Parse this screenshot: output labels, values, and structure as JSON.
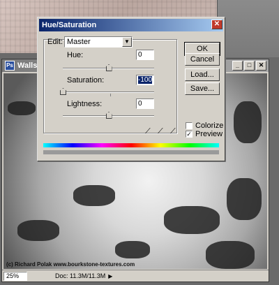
{
  "doc_window": {
    "title": "Walls-pl",
    "zoom": "25%",
    "doc_info": "Doc: 11.3M/11.3M",
    "watermark": "(c) Richard Polak www.bourkstone-textures.com"
  },
  "dialog": {
    "title": "Hue/Saturation",
    "edit_label": "Edit:",
    "edit_value": "Master",
    "hue_label": "Hue:",
    "hue_value": "0",
    "saturation_label": "Saturation:",
    "saturation_value": "-100",
    "lightness_label": "Lightness:",
    "lightness_value": "0",
    "buttons": {
      "ok": "OK",
      "cancel": "Cancel",
      "load": "Load...",
      "save": "Save..."
    },
    "colorize_label": "Colorize",
    "colorize_checked": false,
    "preview_label": "Preview",
    "preview_checked": true,
    "sliders": {
      "hue_fraction": 0.5,
      "saturation_fraction": 0.0,
      "lightness_fraction": 0.5
    }
  },
  "colors": {
    "title_active": "#0a246a",
    "title_inactive": "#7b7b7b",
    "close_red": "#c0392b"
  }
}
